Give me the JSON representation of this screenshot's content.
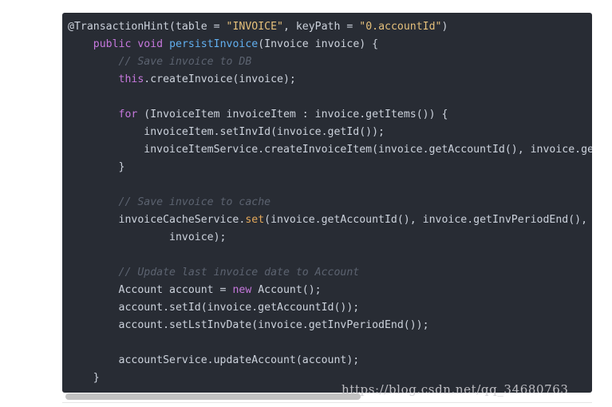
{
  "code_block": {
    "language": "java",
    "lines": [
      [
        {
          "t": "@TransactionHint(table = ",
          "c": "plain"
        },
        {
          "t": "\"INVOICE\"",
          "c": "string"
        },
        {
          "t": ", keyPath = ",
          "c": "plain"
        },
        {
          "t": "\"0.accountId\"",
          "c": "string"
        },
        {
          "t": ")",
          "c": "plain"
        }
      ],
      [
        {
          "t": "    ",
          "c": "plain"
        },
        {
          "t": "public",
          "c": "keyword"
        },
        {
          "t": " ",
          "c": "plain"
        },
        {
          "t": "void",
          "c": "keyword"
        },
        {
          "t": " ",
          "c": "plain"
        },
        {
          "t": "persistInvoice",
          "c": "fn"
        },
        {
          "t": "(Invoice invoice) {",
          "c": "plain"
        }
      ],
      [
        {
          "t": "        ",
          "c": "plain"
        },
        {
          "t": "// Save invoice to DB",
          "c": "comment"
        }
      ],
      [
        {
          "t": "        ",
          "c": "plain"
        },
        {
          "t": "this",
          "c": "keyword"
        },
        {
          "t": ".createInvoice(invoice);",
          "c": "plain"
        }
      ],
      [],
      [
        {
          "t": "        ",
          "c": "plain"
        },
        {
          "t": "for",
          "c": "keyword"
        },
        {
          "t": " (InvoiceItem invoiceItem : invoice.getItems()) {",
          "c": "plain"
        }
      ],
      [
        {
          "t": "            invoiceItem.setInvId(invoice.getId());",
          "c": "plain"
        }
      ],
      [
        {
          "t": "            invoiceItemService.createInvoiceItem(invoice.getAccountId(), invoice.getId(), invoiceItem);",
          "c": "plain"
        }
      ],
      [
        {
          "t": "        }",
          "c": "plain"
        }
      ],
      [],
      [
        {
          "t": "        ",
          "c": "plain"
        },
        {
          "t": "// Save invoice to cache",
          "c": "comment"
        }
      ],
      [
        {
          "t": "        invoiceCacheService.",
          "c": "plain"
        },
        {
          "t": "set",
          "c": "method"
        },
        {
          "t": "(invoice.getAccountId(), invoice.getInvPeriodEnd(),",
          "c": "plain"
        }
      ],
      [
        {
          "t": "                invoice);",
          "c": "plain"
        }
      ],
      [],
      [
        {
          "t": "        ",
          "c": "plain"
        },
        {
          "t": "// Update last invoice date to Account",
          "c": "comment"
        }
      ],
      [
        {
          "t": "        Account account = ",
          "c": "plain"
        },
        {
          "t": "new",
          "c": "keyword"
        },
        {
          "t": " Account();",
          "c": "plain"
        }
      ],
      [
        {
          "t": "        account.setId(invoice.getAccountId());",
          "c": "plain"
        }
      ],
      [
        {
          "t": "        account.setLstInvDate(invoice.getInvPeriodEnd());",
          "c": "plain"
        }
      ],
      [],
      [
        {
          "t": "        accountService.updateAccount(account);",
          "c": "plain"
        }
      ],
      [
        {
          "t": "    }",
          "c": "plain"
        }
      ]
    ]
  },
  "watermark": {
    "text": "https://blog.csdn.net/qq_34680763"
  },
  "colors": {
    "background": "#282c34",
    "plain": "#ccd2dc",
    "keyword": "#c678dd",
    "string": "#e5c07b",
    "function": "#61afef",
    "method": "#e5a95a",
    "comment": "#5c6370"
  }
}
